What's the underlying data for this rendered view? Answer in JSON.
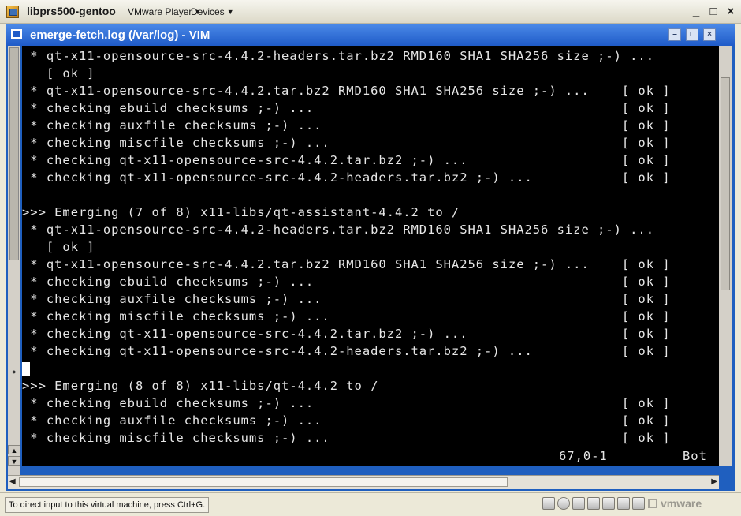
{
  "vmware": {
    "title": "libprs500-gentoo",
    "menus": {
      "player": "VMware Player",
      "devices": "Devices"
    },
    "window_controls": {
      "minimize": "_",
      "maximize": "□",
      "close": "×"
    },
    "status_hint": "To direct input to this virtual machine, press Ctrl+G.",
    "logo_text": "vmware",
    "device_icons": [
      "hard-disk-icon",
      "cd-drive-icon",
      "floppy-icon",
      "network-icon",
      "sound-icon",
      "usb-icon",
      "printer-icon"
    ]
  },
  "vim": {
    "title": "emerge-fetch.log (/var/log) - VIM",
    "lines": [
      " * qt-x11-opensource-src-4.4.2-headers.tar.bz2 RMD160 SHA1 SHA256 size ;-) ...",
      "   [ ok ]",
      " * qt-x11-opensource-src-4.4.2.tar.bz2 RMD160 SHA1 SHA256 size ;-) ...    [ ok ]",
      " * checking ebuild checksums ;-) ...                                      [ ok ]",
      " * checking auxfile checksums ;-) ...                                     [ ok ]",
      " * checking miscfile checksums ;-) ...                                    [ ok ]",
      " * checking qt-x11-opensource-src-4.4.2.tar.bz2 ;-) ...                   [ ok ]",
      " * checking qt-x11-opensource-src-4.4.2-headers.tar.bz2 ;-) ...           [ ok ]",
      "",
      ">>> Emerging (7 of 8) x11-libs/qt-assistant-4.4.2 to /",
      " * qt-x11-opensource-src-4.4.2-headers.tar.bz2 RMD160 SHA1 SHA256 size ;-) ...",
      "   [ ok ]",
      " * qt-x11-opensource-src-4.4.2.tar.bz2 RMD160 SHA1 SHA256 size ;-) ...    [ ok ]",
      " * checking ebuild checksums ;-) ...                                      [ ok ]",
      " * checking auxfile checksums ;-) ...                                     [ ok ]",
      " * checking miscfile checksums ;-) ...                                    [ ok ]",
      " * checking qt-x11-opensource-src-4.4.2.tar.bz2 ;-) ...                   [ ok ]",
      " * checking qt-x11-opensource-src-4.4.2-headers.tar.bz2 ;-) ...           [ ok ]",
      "",
      ">>> Emerging (8 of 8) x11-libs/qt-4.4.2 to /",
      " * checking ebuild checksums ;-) ...                                      [ ok ]",
      " * checking auxfile checksums ;-) ...                                     [ ok ]",
      " * checking miscfile checksums ;-) ...                                    [ ok ]"
    ],
    "cursor_line_index": 18,
    "status_position": "67,0-1",
    "status_scroll": "Bot"
  },
  "colors": {
    "terminal_bg": "#000000",
    "terminal_fg": "#e6e6e6",
    "titlebar_blue": "#1f5bc8"
  }
}
